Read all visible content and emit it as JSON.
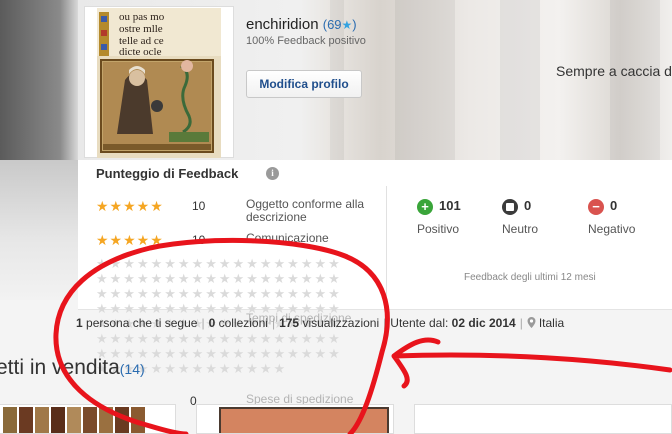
{
  "profile": {
    "username": "enchiridion",
    "score_open": "(",
    "score": "69",
    "score_star": "★",
    "score_close": ")",
    "positive_feedback": "100% Feedback positivo",
    "edit_button": "Modifica profilo",
    "slogan": "Sempre a caccia d"
  },
  "feedback": {
    "title": "Punteggio di Feedback",
    "info_glyph": "i",
    "ratings": [
      {
        "stars": "★★★★★",
        "count": "10",
        "label": "Oggetto conforme alla descrizione"
      },
      {
        "stars": "★★★★★",
        "count": "10",
        "label": "Comunicazione"
      }
    ],
    "hidden_labels": [
      "Tempi di spedizione",
      "Spese di spedizione"
    ],
    "stats": [
      {
        "value": "101",
        "label": "Positivo",
        "glyph": "+"
      },
      {
        "value": "0",
        "label": "Neutro",
        "glyph": ""
      },
      {
        "value": "0",
        "label": "Negativo",
        "glyph": "−"
      }
    ],
    "period": "Feedback degli ultimi 12 mesi"
  },
  "stats_line": {
    "followers_count": "1",
    "followers_label": " persona che ti segue",
    "collections_count": "0",
    "collections_label": " collezioni",
    "views_count": "175",
    "views_label": " visualizzazioni",
    "member_since_label": "Utente dal: ",
    "member_since": "02 dic 2014",
    "location": "Italia",
    "separator": "|"
  },
  "for_sale": {
    "heading": "etti in vendita",
    "count": "(14)",
    "row_value": "0"
  },
  "avatar_text": [
    "ou pas mo",
    "ostre mlle",
    "telle ad ce",
    "dicte ocle"
  ],
  "colors": {
    "annotation": "#e8141c",
    "star": "#f5a623",
    "link": "#2b6cb0"
  }
}
